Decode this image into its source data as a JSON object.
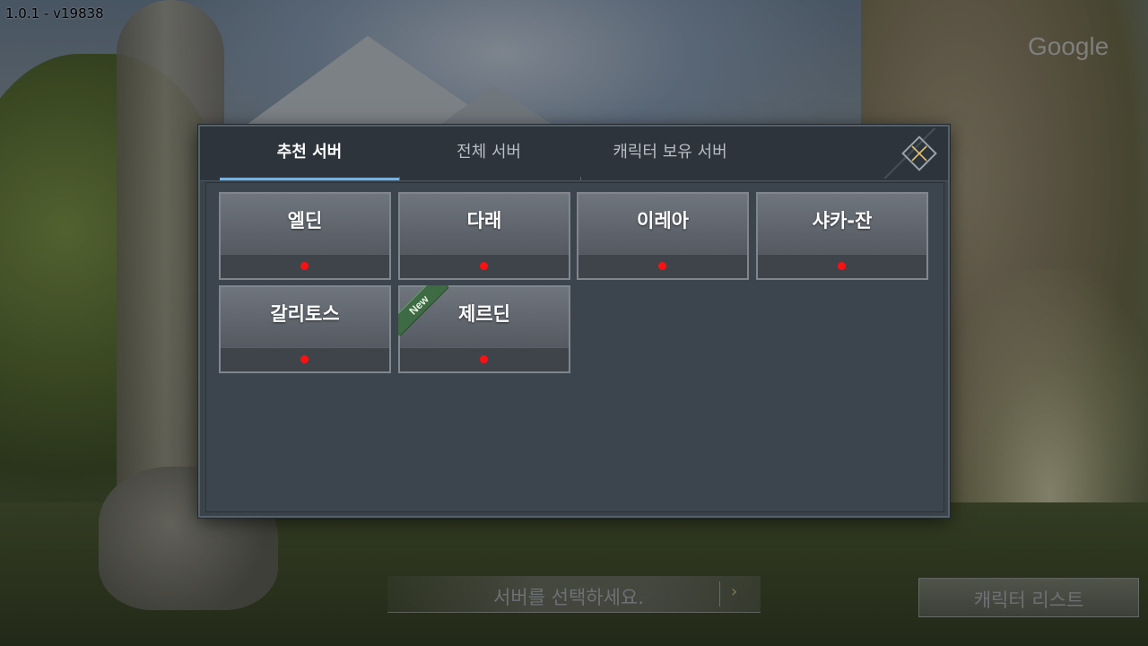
{
  "version": "1.0.1 - v19838",
  "watermark": "Google",
  "tabs": [
    {
      "label": "추천 서버",
      "active": true
    },
    {
      "label": "전체 서버",
      "active": false
    },
    {
      "label": "캐릭터 보유 서버",
      "active": false
    }
  ],
  "close_icon": "close-icon",
  "servers": [
    {
      "name": "엘딘",
      "status_color": "#ff1010",
      "is_new": false
    },
    {
      "name": "다래",
      "status_color": "#ff1010",
      "is_new": false
    },
    {
      "name": "이레아",
      "status_color": "#ff1010",
      "is_new": false
    },
    {
      "name": "샤카-잔",
      "status_color": "#ff1010",
      "is_new": false
    },
    {
      "name": "갈리토스",
      "status_color": "#ff1010",
      "is_new": false
    },
    {
      "name": "제르딘",
      "status_color": "#ff1010",
      "is_new": true,
      "badge": "New"
    }
  ],
  "bottom": {
    "server_select_placeholder": "서버를 선택하세요.",
    "arrow_icon": "chevron-right-icon",
    "character_list_label": "캐릭터 리스트"
  },
  "colors": {
    "tab_active_underline": "#72b3e6",
    "status_offline": "#ff1010",
    "new_badge": "#3e6a44"
  }
}
